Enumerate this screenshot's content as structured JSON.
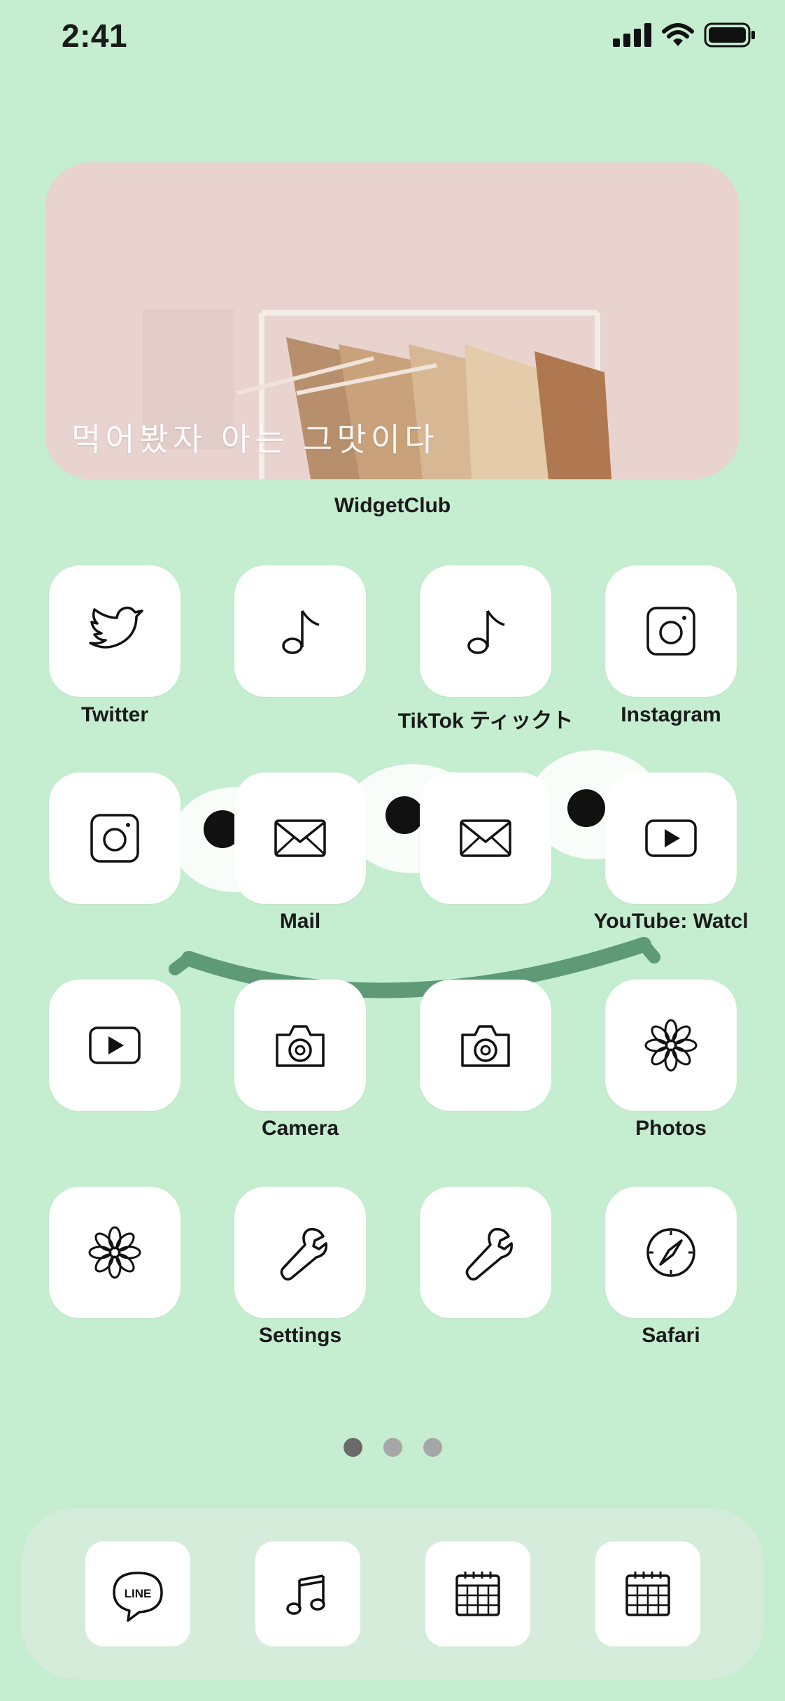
{
  "status_bar": {
    "time": "2:41",
    "icons": [
      "signal-icon",
      "wifi-icon",
      "battery-icon"
    ]
  },
  "widget": {
    "caption": "먹어봤자 아는 그맛이다",
    "label": "WidgetClub"
  },
  "apps": [
    {
      "label": "Twitter",
      "icon": "bird-icon"
    },
    {
      "label": "",
      "icon": "music-note-icon"
    },
    {
      "label": "TikTok ティックト",
      "icon": "music-note-icon"
    },
    {
      "label": "Instagram",
      "icon": "camera-square-icon"
    },
    {
      "label": "",
      "icon": "camera-square-icon"
    },
    {
      "label": "Mail",
      "icon": "envelope-icon"
    },
    {
      "label": "",
      "icon": "envelope-icon"
    },
    {
      "label": "YouTube: Watcl",
      "icon": "play-icon"
    },
    {
      "label": "",
      "icon": "play-icon"
    },
    {
      "label": "Camera",
      "icon": "camera-icon"
    },
    {
      "label": "",
      "icon": "camera-icon"
    },
    {
      "label": "Photos",
      "icon": "flower-icon"
    },
    {
      "label": "",
      "icon": "flower-icon"
    },
    {
      "label": "Settings",
      "icon": "wrench-icon"
    },
    {
      "label": "",
      "icon": "wrench-icon"
    },
    {
      "label": "Safari",
      "icon": "compass-icon"
    }
  ],
  "page_indicator": {
    "pages": 3,
    "current": 1
  },
  "dock": [
    {
      "icon": "line-chat-icon",
      "text": "LINE"
    },
    {
      "icon": "music-notes-icon"
    },
    {
      "icon": "calendar-icon"
    },
    {
      "icon": "calendar-icon"
    }
  ]
}
